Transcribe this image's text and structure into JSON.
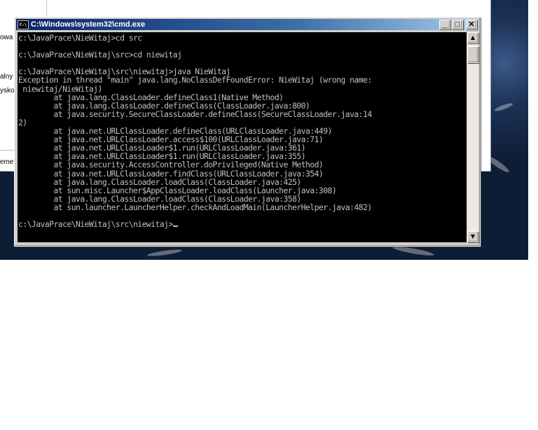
{
  "background_window": {
    "edge_texts": [
      "owa",
      "alny",
      "ysko",
      "eme"
    ]
  },
  "cmd_window": {
    "title": "C:\\Windows\\system32\\cmd.exe",
    "icon": "cmd-icon",
    "controls": {
      "minimize": "_",
      "maximize": "□",
      "close": "✕"
    },
    "console_text": "c:\\JavaPrace\\NieWitaj>cd src\n\nc:\\JavaPrace\\NieWitaj\\src>cd niewitaj\n\nc:\\JavaPrace\\NieWitaj\\src\\niewitaj>java NieWitaj\nException in thread \"main\" java.lang.NoClassDefFoundError: NieWitaj (wrong name:\n niewitaj/NieWitaj)\n        at java.lang.ClassLoader.defineClass1(Native Method)\n        at java.lang.ClassLoader.defineClass(ClassLoader.java:800)\n        at java.security.SecureClassLoader.defineClass(SecureClassLoader.java:14\n2)\n        at java.net.URLClassLoader.defineClass(URLClassLoader.java:449)\n        at java.net.URLClassLoader.access$100(URLClassLoader.java:71)\n        at java.net.URLClassLoader$1.run(URLClassLoader.java:361)\n        at java.net.URLClassLoader$1.run(URLClassLoader.java:355)\n        at java.security.AccessController.doPrivileged(Native Method)\n        at java.net.URLClassLoader.findClass(URLClassLoader.java:354)\n        at java.lang.ClassLoader.loadClass(ClassLoader.java:425)\n        at sun.misc.Launcher$AppClassLoader.loadClass(Launcher.java:308)\n        at java.lang.ClassLoader.loadClass(ClassLoader.java:358)\n        at sun.launcher.LauncherHelper.checkAndLoadMain(LauncherHelper.java:482)\n\n",
    "prompt": "c:\\JavaPrace\\NieWitaj\\src\\niewitaj>"
  },
  "colors": {
    "title_bar": "#0a246a",
    "console_bg": "#000000",
    "console_fg": "#c0c0c0"
  }
}
